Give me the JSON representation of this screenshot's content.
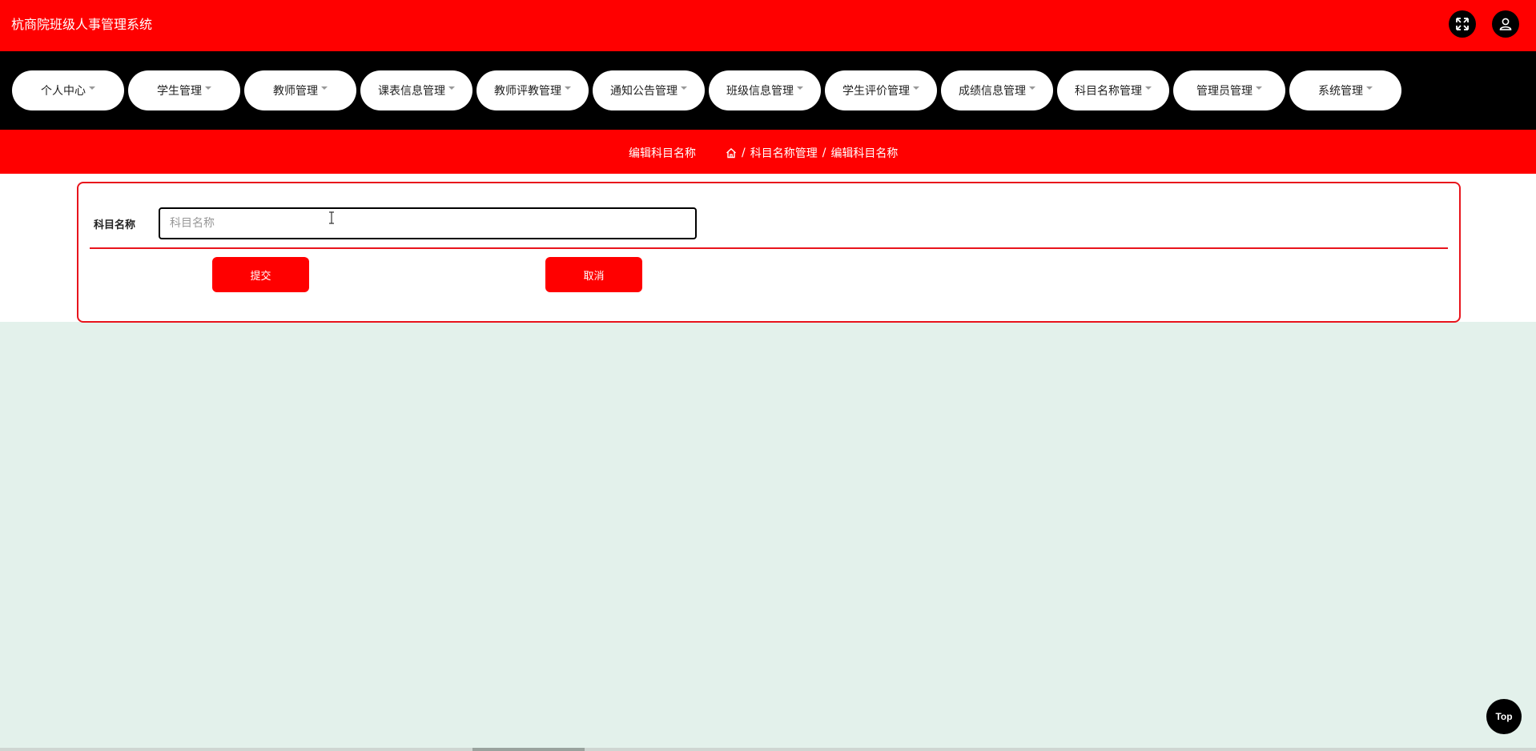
{
  "app": {
    "title": "杭商院班级人事管理系统"
  },
  "header": {
    "icons": [
      "fullscreen-icon",
      "user-icon"
    ]
  },
  "nav": {
    "items": [
      {
        "label": "个人中心"
      },
      {
        "label": "学生管理"
      },
      {
        "label": "教师管理"
      },
      {
        "label": "课表信息管理"
      },
      {
        "label": "教师评教管理"
      },
      {
        "label": "通知公告管理"
      },
      {
        "label": "班级信息管理"
      },
      {
        "label": "学生评价管理"
      },
      {
        "label": "成绩信息管理"
      },
      {
        "label": "科目名称管理"
      },
      {
        "label": "管理员管理"
      },
      {
        "label": "系统管理"
      }
    ]
  },
  "breadcrumb": {
    "page_title": "编辑科目名称",
    "home_icon": "home-icon",
    "separator": "/",
    "items": [
      "科目名称管理",
      "编辑科目名称"
    ]
  },
  "form": {
    "field_label": "科目名称",
    "field_value": "",
    "field_placeholder": "科目名称",
    "submit_label": "提交",
    "cancel_label": "取消"
  },
  "back_to_top": {
    "label": "Top"
  },
  "colors": {
    "primary": "#ff0000",
    "nav_bg": "#000000",
    "page_bg": "#e3f1eb",
    "card_border": "#e8141c"
  }
}
